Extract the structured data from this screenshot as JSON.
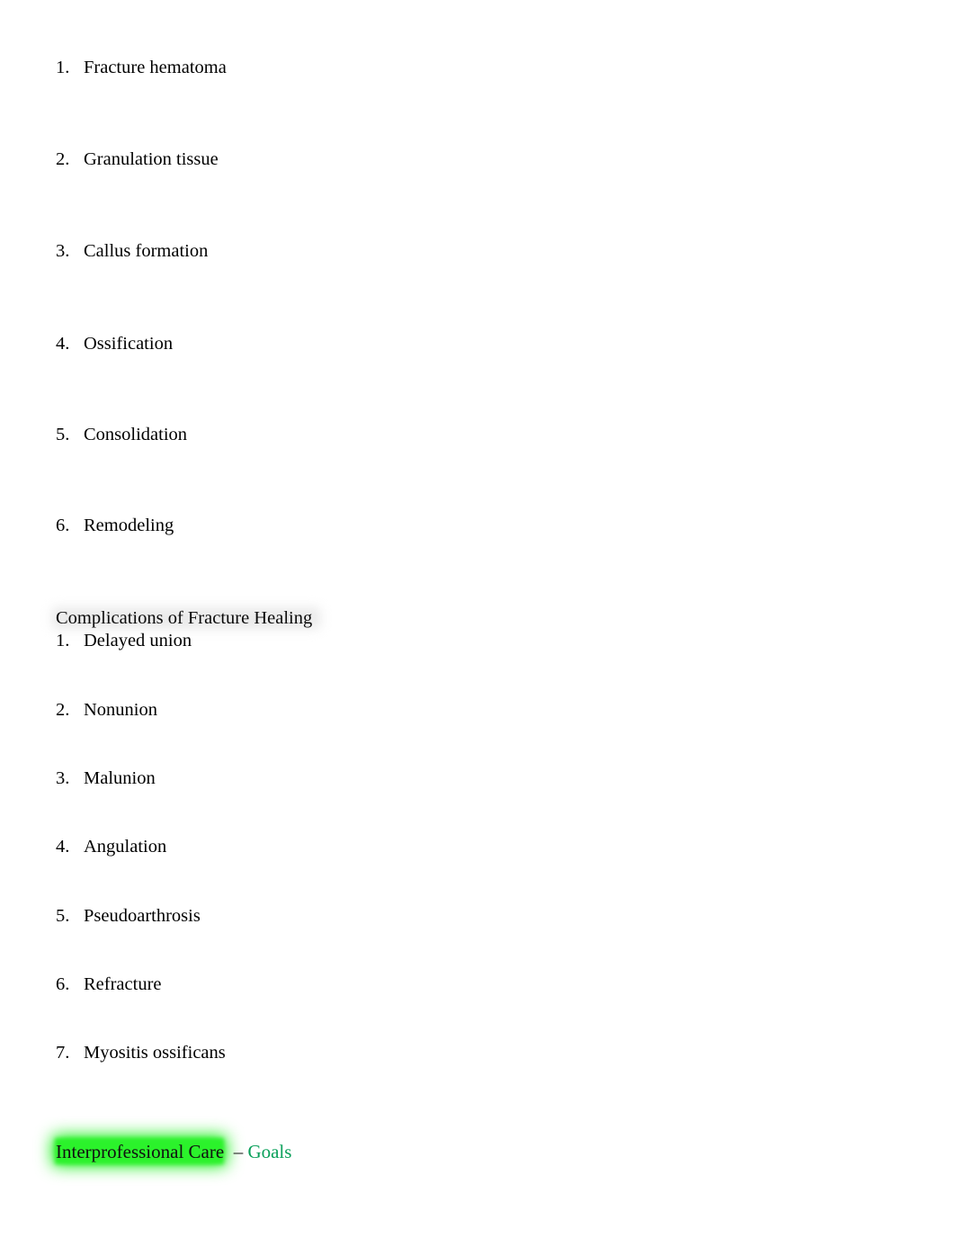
{
  "document": {
    "background_color": "#ffffff",
    "text_color": "#000000"
  },
  "healing_stages_list": {
    "items": [
      {
        "number": "1.",
        "label": "Fracture hematoma"
      },
      {
        "number": "2.",
        "label": "Granulation tissue"
      },
      {
        "number": "3.",
        "label": "Callus formation"
      },
      {
        "number": "4.",
        "label": "Ossification"
      },
      {
        "number": "5.",
        "label": "Consolidation"
      },
      {
        "number": "6.",
        "label": "Remodeling"
      }
    ]
  },
  "complications_section": {
    "heading": "Complications of Fracture Healing",
    "heading_highlight_color": "#e9e9e9",
    "items": [
      {
        "number": "1.",
        "label": "Delayed union"
      },
      {
        "number": "2.",
        "label": "Nonunion"
      },
      {
        "number": "3.",
        "label": "Malunion"
      },
      {
        "number": "4.",
        "label": "Angulation"
      },
      {
        "number": "5.",
        "label": "Pseudoarthrosis"
      },
      {
        "number": "6.",
        "label": "Refracture"
      },
      {
        "number": "7.",
        "label": "Myositis ossificans"
      }
    ]
  },
  "footer_section": {
    "highlighted_text": "Interprofessional Care",
    "highlight_color": "#2bf22b",
    "separator": "–",
    "trailing_text": "Goals",
    "trailing_text_color": "#0aa05a"
  }
}
